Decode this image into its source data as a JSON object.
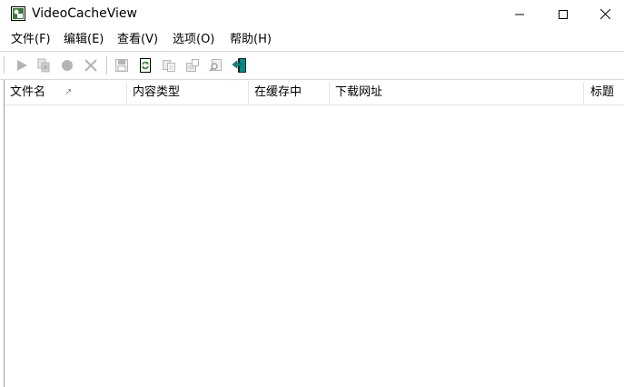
{
  "window": {
    "title": "VideoCacheView"
  },
  "icons": {
    "app": "app-icon",
    "minimize": "minimize-icon",
    "maximize": "maximize-icon",
    "close": "close-icon"
  },
  "menu": [
    {
      "label": "文件(F)"
    },
    {
      "label": "编辑(E)"
    },
    {
      "label": "查看(V)"
    },
    {
      "label": "选项(O)"
    },
    {
      "label": "帮助(H)"
    }
  ],
  "toolbar": {
    "buttons": [
      "play-icon",
      "copy-to-folder-icon",
      "record-icon",
      "delete-icon",
      "save-icon",
      "refresh-icon",
      "copy-icon",
      "properties-icon",
      "find-icon",
      "exit-icon"
    ]
  },
  "list": {
    "columns": [
      {
        "label": "文件名",
        "sorted": true
      },
      {
        "label": "内容类型"
      },
      {
        "label": "在缓存中"
      },
      {
        "label": "下载网址"
      },
      {
        "label": "标题"
      }
    ],
    "sort_indicator": "↗",
    "rows": []
  },
  "colors": {
    "disabled_icon": "#b4b4b4",
    "refresh_green": "#2e8b2e",
    "exit_teal": "#008b8b"
  }
}
